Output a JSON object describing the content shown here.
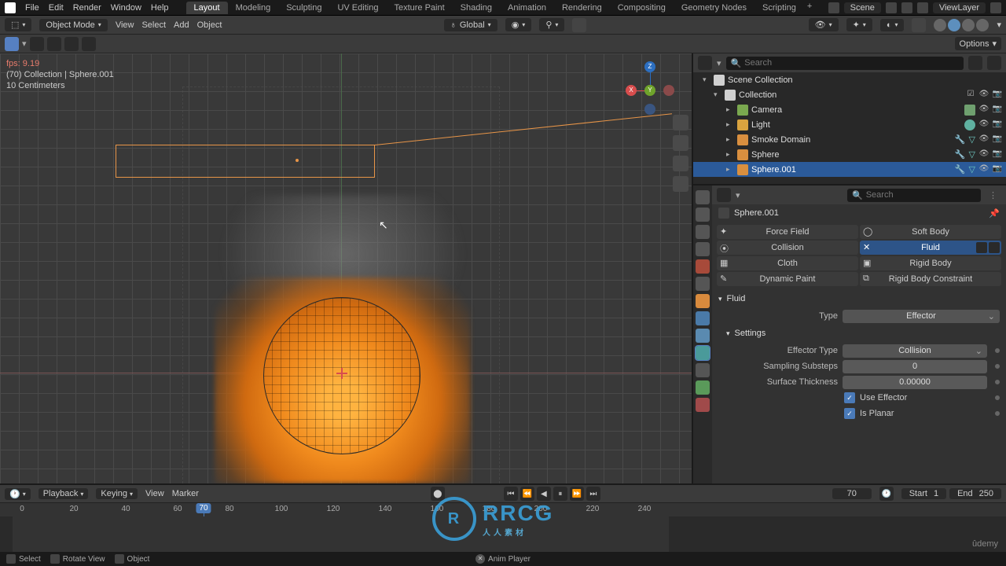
{
  "topbar": {
    "menus": [
      "File",
      "Edit",
      "Render",
      "Window",
      "Help"
    ],
    "workspaces": [
      "Layout",
      "Modeling",
      "Sculpting",
      "UV Editing",
      "Texture Paint",
      "Shading",
      "Animation",
      "Rendering",
      "Compositing",
      "Geometry Nodes",
      "Scripting"
    ],
    "active_workspace": "Layout",
    "scene": "Scene",
    "viewlayer": "ViewLayer"
  },
  "toolheader": {
    "mode": "Object Mode",
    "menus": [
      "View",
      "Select",
      "Add",
      "Object"
    ],
    "orientation": "Global"
  },
  "toolshelf": {
    "options": "Options"
  },
  "viewport": {
    "fps": "fps: 9.19",
    "collection_line": "(70) Collection | Sphere.001",
    "units": "10 Centimeters",
    "axes": {
      "x": "X",
      "y": "Y",
      "z": "Z"
    }
  },
  "outliner": {
    "search_placeholder": "Search",
    "tree": {
      "scene_collection": "Scene Collection",
      "collection": "Collection",
      "items": [
        {
          "name": "Camera",
          "type": "cam"
        },
        {
          "name": "Light",
          "type": "light"
        },
        {
          "name": "Smoke Domain",
          "type": "mesh",
          "mod": true,
          "phys": true
        },
        {
          "name": "Sphere",
          "type": "mesh",
          "mod": true,
          "phys": true
        },
        {
          "name": "Sphere.001",
          "type": "mesh",
          "mod": true,
          "phys": true,
          "selected": true
        }
      ]
    }
  },
  "properties": {
    "search_placeholder": "Search",
    "breadcrumb": "Sphere.001",
    "physics_buttons": {
      "force_field": "Force Field",
      "soft_body": "Soft Body",
      "collision": "Collision",
      "fluid": "Fluid",
      "cloth": "Cloth",
      "rigid_body": "Rigid Body",
      "dynamic_paint": "Dynamic Paint",
      "rigid_body_constraint": "Rigid Body Constraint"
    },
    "fluid_panel": "Fluid",
    "type_label": "Type",
    "type_value": "Effector",
    "settings_panel": "Settings",
    "effector_type_label": "Effector Type",
    "effector_type_value": "Collision",
    "sampling_label": "Sampling Substeps",
    "sampling_value": "0",
    "thickness_label": "Surface Thickness",
    "thickness_value": "0.00000",
    "use_effector": "Use Effector",
    "is_planar": "Is Planar"
  },
  "timeline": {
    "playback": "Playback",
    "keying": "Keying",
    "view": "View",
    "marker": "Marker",
    "current_frame": "70",
    "start_label": "Start",
    "start": "1",
    "end_label": "End",
    "end": "250",
    "ticks": [
      "0",
      "20",
      "40",
      "60",
      "80",
      "100",
      "120",
      "140",
      "160",
      "180",
      "200",
      "220",
      "240"
    ],
    "playhead": "70"
  },
  "statusbar": {
    "select": "Select",
    "rotate": "Rotate View",
    "object": "Object",
    "anim_player": "Anim Player"
  },
  "watermark": {
    "big": "RRCG",
    "sub": "人人素材"
  },
  "udemy": "ûdemy"
}
